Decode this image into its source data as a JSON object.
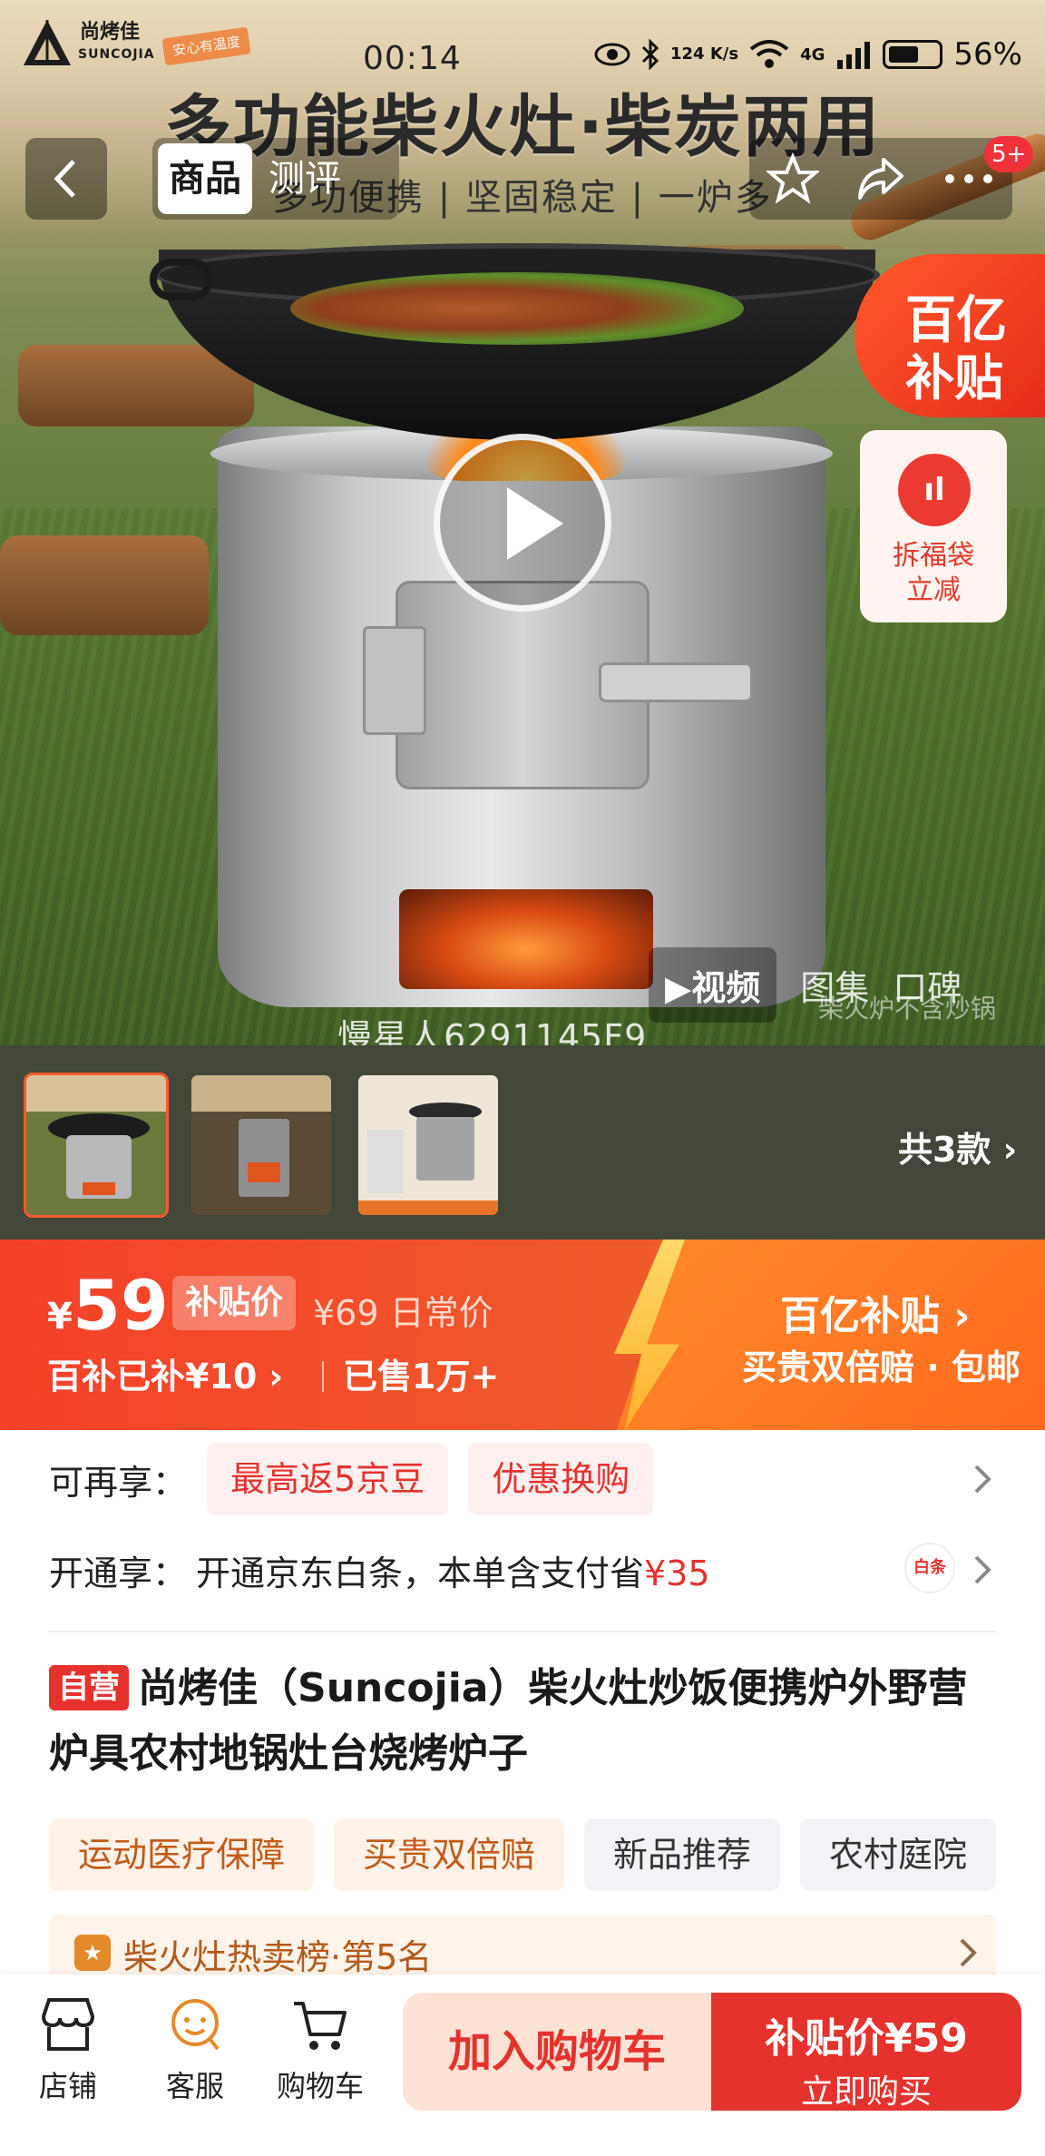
{
  "status_bar": {
    "brand_name": "尚烤佳",
    "brand_en": "SUNCOJIA",
    "brand_tag": "安心有温度",
    "time": "00:14",
    "network_speed": "124 K/s",
    "network_type": "4G",
    "battery": "56%"
  },
  "banner": {
    "title": "多功能柴火灶·柴炭两用",
    "subtitle": "多功便携 | 坚固稳定 | 一炉多"
  },
  "nav": {
    "tabs": [
      {
        "label": "商品",
        "active": true
      },
      {
        "label": "测评",
        "active": false
      }
    ],
    "badge": "5+",
    "icons": [
      "back-icon",
      "favorite-icon",
      "share-icon",
      "more-icon"
    ]
  },
  "hero": {
    "subsidy_line1": "百亿",
    "subsidy_line2": "补贴",
    "fortune_icon": "ıl",
    "fortune_text_1": "拆福袋",
    "fortune_text_2": "立减",
    "media_tabs": [
      "▶视频",
      "图集",
      "口碑"
    ],
    "media_note": "柴火炉不含炒锅",
    "watermark": "慢星人6291145F9"
  },
  "variants": {
    "count_label": "共3款 ›",
    "thumbs": [
      {
        "name": "variant-1",
        "selected": true
      },
      {
        "name": "variant-2",
        "selected": false
      },
      {
        "name": "variant-3",
        "selected": false
      }
    ]
  },
  "price": {
    "currency": "¥",
    "current": "59",
    "tag": "补贴价",
    "original": "¥69 日常价",
    "subsidy_detail": "百补已补¥10 ›",
    "sold": "已售1万+",
    "right_title": "百亿补贴 ›",
    "right_sub": "买贵双倍赔 · 包邮"
  },
  "benefits": {
    "row1_label": "可再享：",
    "row1_chips": [
      "最高返5京豆",
      "优惠换购"
    ],
    "row2_label": "开通享：",
    "row2_text": "开通京东白条，本单含支付省",
    "row2_amount": "¥35",
    "baitiao_icon": "白条"
  },
  "product": {
    "self_tag": "自营",
    "title": "尚烤佳（Suncojia）柴火灶炒饭便携炉外野营炉具农村地锅灶台烧烤炉子"
  },
  "service_tags": [
    {
      "label": "运动医疗保障",
      "style": "warm"
    },
    {
      "label": "买贵双倍赔",
      "style": "warm"
    },
    {
      "label": "新品推荐",
      "style": "cool"
    },
    {
      "label": "农村庭院",
      "style": "cool"
    }
  ],
  "ranking": {
    "text": "柴火灶热卖榜·第5名"
  },
  "bottom_bar": {
    "store_label": "店铺",
    "service_label": "客服",
    "cart_label": "购物车",
    "add_cart_button": "加入购物车",
    "buy_price": "补贴价¥59",
    "buy_label": "立即购买"
  },
  "colors": {
    "accent_red": "#e5322d",
    "price_orange": "#f5402a",
    "subsidy_orange": "#ff6a1f"
  }
}
